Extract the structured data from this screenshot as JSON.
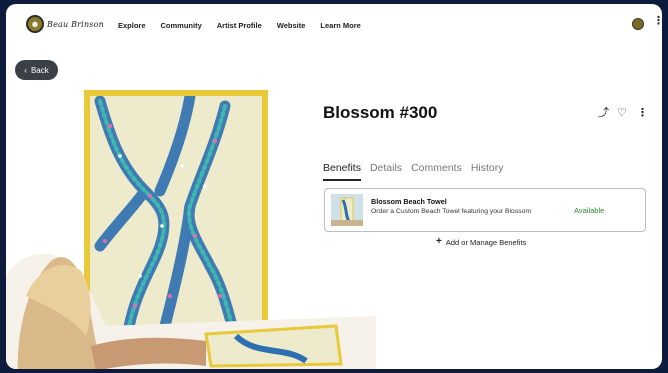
{
  "nav": {
    "logo_text": "Beau Brinson",
    "links": [
      "Explore",
      "Community",
      "Artist Profile",
      "Website",
      "Learn More"
    ],
    "more_glyph": "⋮"
  },
  "back": {
    "label": "Back",
    "glyph": "‹"
  },
  "item": {
    "title": "Blossom #300",
    "actions": {
      "share_glyph": "⤴",
      "favorite_glyph": "♡",
      "more_glyph": "⋮"
    }
  },
  "tabs": [
    "Benefits",
    "Details",
    "Comments",
    "History"
  ],
  "benefit": {
    "name": "Blossom Beach Towel",
    "description": "Order a Custom Beach Towel featuring your Blossom",
    "status": "Available",
    "status_color": "#2e8b2e"
  },
  "add_benefits": {
    "glyph": "+",
    "label": "Add or Manage Benefits"
  },
  "colors": {
    "background": "#0d1b3d",
    "frame": "#e8c93a",
    "art_bg": "#eeeacc",
    "accent": "#2d7bb8"
  }
}
